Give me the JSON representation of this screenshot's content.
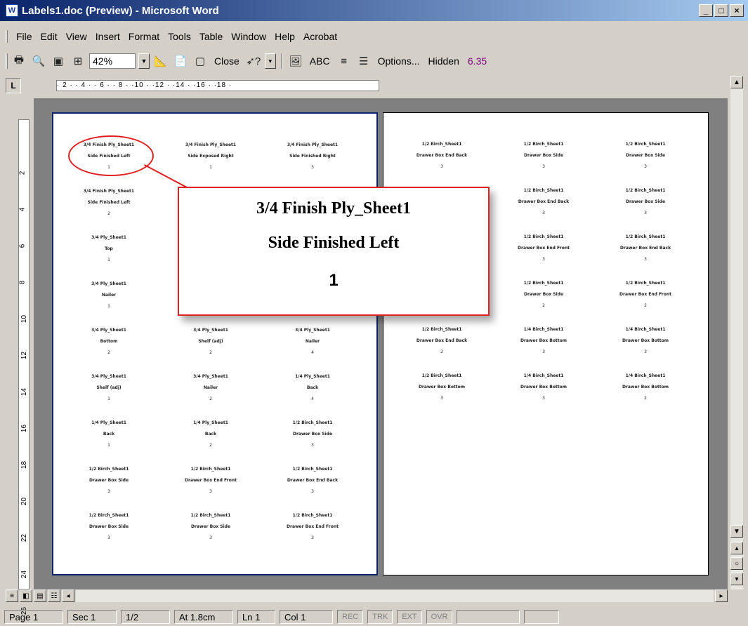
{
  "window": {
    "title": "Labels1.doc (Preview) - Microsoft Word",
    "app_icon": "W",
    "minimize": "_",
    "maximize": "□",
    "close": "×"
  },
  "menu": [
    "File",
    "Edit",
    "View",
    "Insert",
    "Format",
    "Tools",
    "Table",
    "Window",
    "Help",
    "Acrobat"
  ],
  "toolbar": {
    "zoom": "42%",
    "close_label": "Close",
    "abc_label": "ABC",
    "options_label": "Options...",
    "hidden_label": "Hidden",
    "version": "6.35"
  },
  "ruler": {
    "tab_stop": "L",
    "h_ticks": "· 2 ·   · 4 ·   · 6 ·   · 8 ·   ·10 ·  ·12 ·  ·14 ·  ·16 ·  ·18 ·",
    "v_ticks": [
      "2",
      "4",
      "6",
      "8",
      "10",
      "12",
      "14",
      "16",
      "18",
      "20",
      "22",
      "24",
      "26"
    ]
  },
  "magnified_label": {
    "line1": "3/4 Finish Ply_Sheet1",
    "line2": "Side Finished Left",
    "line3": "1"
  },
  "left_page_labels": [
    {
      "l1": "3/4 Finish Ply_Sheet1",
      "l2": "Side Finished Left",
      "l3": "1"
    },
    {
      "l1": "3/4 Finish Ply_Sheet1",
      "l2": "Side Exposed Right",
      "l3": "1"
    },
    {
      "l1": "3/4 Finish Ply_Sheet1",
      "l2": "Side Finished Right",
      "l3": "3"
    },
    {
      "l1": "3/4 Finish Ply_Sheet1",
      "l2": "Side Finished Left",
      "l3": "2"
    },
    {
      "l1": "",
      "l2": "",
      "l3": ""
    },
    {
      "l1": "",
      "l2": "",
      "l3": ""
    },
    {
      "l1": "3/4 Ply_Sheet1",
      "l2": "Top",
      "l3": "1"
    },
    {
      "l1": "",
      "l2": "",
      "l3": ""
    },
    {
      "l1": "",
      "l2": "",
      "l3": ""
    },
    {
      "l1": "3/4 Ply_Sheet1",
      "l2": "Nailer",
      "l3": "1"
    },
    {
      "l1": "",
      "l2": "",
      "l3": ""
    },
    {
      "l1": "",
      "l2": "",
      "l3": ""
    },
    {
      "l1": "3/4 Ply_Sheet1",
      "l2": "Bottom",
      "l3": "2"
    },
    {
      "l1": "3/4 Ply_Sheet1",
      "l2": "Shelf (adj)",
      "l3": "2"
    },
    {
      "l1": "3/4 Ply_Sheet1",
      "l2": "Nailer",
      "l3": "4"
    },
    {
      "l1": "3/4 Ply_Sheet1",
      "l2": "Shelf (adj)",
      "l3": "1"
    },
    {
      "l1": "3/4 Ply_Sheet1",
      "l2": "Nailer",
      "l3": "2"
    },
    {
      "l1": "1/4 Ply_Sheet1",
      "l2": "Back",
      "l3": "4"
    },
    {
      "l1": "1/4 Ply_Sheet1",
      "l2": "Back",
      "l3": "1"
    },
    {
      "l1": "1/4 Ply_Sheet1",
      "l2": "Back",
      "l3": "2"
    },
    {
      "l1": "1/2 Birch_Sheet1",
      "l2": "Drawer Box Side",
      "l3": "3"
    },
    {
      "l1": "1/2 Birch_Sheet1",
      "l2": "Drawer Box Side",
      "l3": "3"
    },
    {
      "l1": "1/2 Birch_Sheet1",
      "l2": "Drawer Box End Front",
      "l3": "3"
    },
    {
      "l1": "1/2 Birch_Sheet1",
      "l2": "Drawer Box End Back",
      "l3": "3"
    },
    {
      "l1": "1/2 Birch_Sheet1",
      "l2": "Drawer Box Side",
      "l3": "3"
    },
    {
      "l1": "1/2 Birch_Sheet1",
      "l2": "Drawer Box Side",
      "l3": "3"
    },
    {
      "l1": "1/2 Birch_Sheet1",
      "l2": "Drawer Box End Front",
      "l3": "3"
    }
  ],
  "right_page_labels": [
    {
      "l1": "1/2 Birch_Sheet1",
      "l2": "Drawer Box End Back",
      "l3": "3"
    },
    {
      "l1": "1/2 Birch_Sheet1",
      "l2": "Drawer Box Side",
      "l3": "3"
    },
    {
      "l1": "1/2 Birch_Sheet1",
      "l2": "Drawer Box Side",
      "l3": "3"
    },
    {
      "l1": "",
      "l2": "",
      "l3": ""
    },
    {
      "l1": "1/2 Birch_Sheet1",
      "l2": "Drawer Box End Back",
      "l3": "3"
    },
    {
      "l1": "1/2 Birch_Sheet1",
      "l2": "Drawer Box Side",
      "l3": "3"
    },
    {
      "l1": "",
      "l2": "",
      "l3": ""
    },
    {
      "l1": "1/2 Birch_Sheet1",
      "l2": "Drawer Box End Front",
      "l3": "3"
    },
    {
      "l1": "1/2 Birch_Sheet1",
      "l2": "Drawer Box End Back",
      "l3": "3"
    },
    {
      "l1": "",
      "l2": "",
      "l3": ""
    },
    {
      "l1": "1/2 Birch_Sheet1",
      "l2": "Drawer Box Side",
      "l3": "2"
    },
    {
      "l1": "1/2 Birch_Sheet1",
      "l2": "Drawer Box End Front",
      "l3": "2"
    },
    {
      "l1": "1/2 Birch_Sheet1",
      "l2": "Drawer Box End Back",
      "l3": "2"
    },
    {
      "l1": "1/4 Birch_Sheet1",
      "l2": "Drawer Box Bottom",
      "l3": "3"
    },
    {
      "l1": "1/4 Birch_Sheet1",
      "l2": "Drawer Box Bottom",
      "l3": "3"
    },
    {
      "l1": "1/2 Birch_Sheet1",
      "l2": "Drawer Box Bottom",
      "l3": "3"
    },
    {
      "l1": "1/4 Birch_Sheet1",
      "l2": "Drawer Box Bottom",
      "l3": "3"
    },
    {
      "l1": "1/4 Birch_Sheet1",
      "l2": "Drawer Box Bottom",
      "l3": "2"
    }
  ],
  "status": {
    "page": "Page 1",
    "sec": "Sec 1",
    "pages": "1/2",
    "at": "At 1.8cm",
    "ln": "Ln 1",
    "col": "Col 1",
    "rec": "REC",
    "trk": "TRK",
    "ext": "EXT",
    "ovr": "OVR"
  }
}
